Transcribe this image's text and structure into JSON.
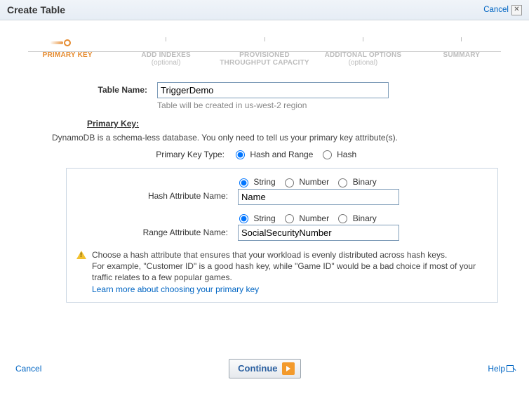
{
  "header": {
    "title": "Create Table",
    "cancel": "Cancel"
  },
  "wizard": {
    "steps": [
      {
        "label": "PRIMARY KEY",
        "sub": ""
      },
      {
        "label": "ADD INDEXES",
        "sub": "(optional)"
      },
      {
        "label": "PROVISIONED THROUGHPUT CAPACITY",
        "sub": ""
      },
      {
        "label": "ADDITONAL OPTIONS",
        "sub": "(optional)"
      },
      {
        "label": "SUMMARY",
        "sub": ""
      }
    ]
  },
  "form": {
    "table_name_label": "Table Name:",
    "table_name_value": "TriggerDemo",
    "table_name_hint": "Table will be created in us-west-2 region",
    "primary_key_heading": "Primary Key:",
    "schema_desc": "DynamoDB is a schema-less database. You only need to tell us your primary key attribute(s).",
    "pk_type_label": "Primary Key Type:",
    "pk_type_options": {
      "hash_and_range": "Hash and Range",
      "hash": "Hash"
    },
    "attr_types": {
      "string": "String",
      "number": "Number",
      "binary": "Binary"
    },
    "hash_label": "Hash Attribute Name:",
    "hash_value": "Name",
    "range_label": "Range Attribute Name:",
    "range_value": "SocialSecurityNumber",
    "warn_line1": "Choose a hash attribute that ensures that your workload is evenly distributed across hash keys.",
    "warn_line2": "For example, \"Customer ID\" is a good hash key, while \"Game ID\" would be a bad choice if most of your traffic relates to a few popular games.",
    "learn_more": "Learn more about choosing your primary key"
  },
  "footer": {
    "cancel": "Cancel",
    "continue": "Continue",
    "help": "Help"
  }
}
